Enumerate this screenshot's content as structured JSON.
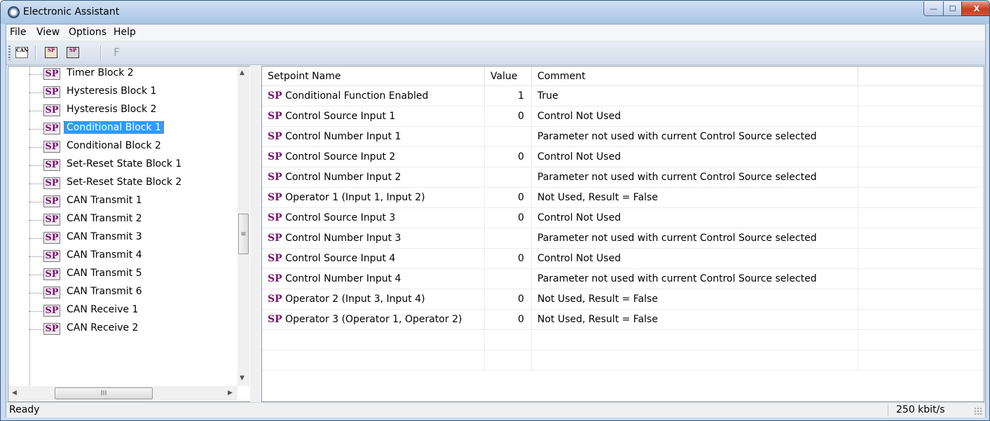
{
  "window": {
    "title": "Electronic Assistant",
    "controls": {
      "minimize": "—",
      "maximize": "☐",
      "close": "X"
    }
  },
  "menu": [
    "File",
    "View",
    "Options",
    "Help"
  ],
  "toolbar": {
    "buttons": [
      {
        "name": "can-connect",
        "icon": "can-icon",
        "glyph": "CAN"
      },
      {
        "name": "sp-download",
        "icon": "sp-download-icon",
        "glyph": "SP"
      },
      {
        "name": "sp-save",
        "icon": "sp-save-icon",
        "glyph": "SP"
      }
    ],
    "f_label": "F"
  },
  "tree": {
    "icon_text": "SP",
    "selected_index": 3,
    "items": [
      "Timer Block 2",
      "Hysteresis Block 1",
      "Hysteresis Block 2",
      "Conditional Block 1",
      "Conditional Block 2",
      "Set-Reset State Block 1",
      "Set-Reset State Block 2",
      "CAN Transmit 1",
      "CAN Transmit 2",
      "CAN Transmit 3",
      "CAN Transmit 4",
      "CAN Transmit 5",
      "CAN Transmit 6",
      "CAN Receive 1",
      "CAN Receive 2"
    ],
    "scroll_up": "▲",
    "scroll_down": "▼",
    "scroll_left": "◀",
    "scroll_right": "▶",
    "thumb_grip": "≡",
    "hthumb_grip": "III"
  },
  "table": {
    "columns": [
      "Setpoint Name",
      "Value",
      "Comment"
    ],
    "tag": "SP",
    "rows": [
      {
        "name": "Conditional Function Enabled",
        "value": "1",
        "comment": "True"
      },
      {
        "name": "Control Source Input 1",
        "value": "0",
        "comment": "Control Not Used"
      },
      {
        "name": "Control Number Input 1",
        "value": "",
        "comment": "Parameter not used with current Control Source selected"
      },
      {
        "name": "Control Source Input 2",
        "value": "0",
        "comment": "Control Not Used"
      },
      {
        "name": "Control Number Input 2",
        "value": "",
        "comment": "Parameter not used with current Control Source selected"
      },
      {
        "name": "Operator 1 (Input 1, Input 2)",
        "value": "0",
        "comment": "Not Used, Result = False"
      },
      {
        "name": "Control Source Input 3",
        "value": "0",
        "comment": "Control Not Used"
      },
      {
        "name": "Control Number Input 3",
        "value": "",
        "comment": "Parameter not used with current Control Source selected"
      },
      {
        "name": "Control Source Input 4",
        "value": "0",
        "comment": "Control Not Used"
      },
      {
        "name": "Control Number Input 4",
        "value": "",
        "comment": "Parameter not used with current Control Source selected"
      },
      {
        "name": "Operator 2 (Input 3, Input 4)",
        "value": "0",
        "comment": "Not Used, Result = False"
      },
      {
        "name": "Operator 3 (Operator 1, Operator 2)",
        "value": "0",
        "comment": "Not Used, Result = False"
      }
    ]
  },
  "status": {
    "left": "Ready",
    "right": "250 kbit/s"
  }
}
